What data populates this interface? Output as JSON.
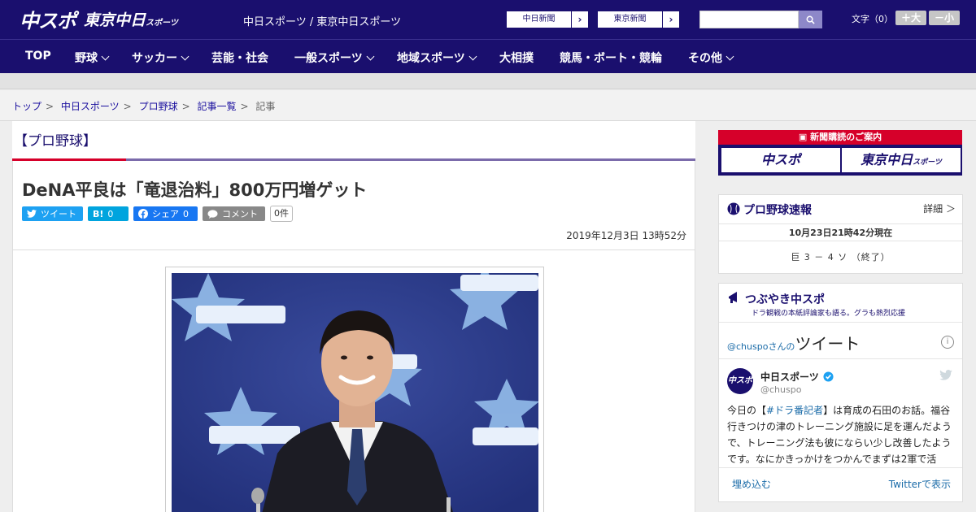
{
  "header": {
    "logo_primary": "中スポ",
    "logo_secondary": "東京中日",
    "logo_secondary_small": "スポーツ",
    "site_title": "中日スポーツ / 東京中日スポーツ",
    "paper_links": [
      {
        "label": "中日新聞"
      },
      {
        "label": "東京新聞"
      }
    ],
    "search_placeholder": "",
    "font_size_label": "文字（0）",
    "font_larger": "＋大",
    "font_smaller": "－小"
  },
  "nav": {
    "items": [
      {
        "label": "TOP",
        "has_dropdown": false
      },
      {
        "label": "野球",
        "has_dropdown": true
      },
      {
        "label": "サッカー",
        "has_dropdown": true
      },
      {
        "label": "芸能・社会",
        "has_dropdown": false
      },
      {
        "label": "一般スポーツ",
        "has_dropdown": true
      },
      {
        "label": "地域スポーツ",
        "has_dropdown": true
      },
      {
        "label": "大相撲",
        "has_dropdown": false
      },
      {
        "label": "競馬・ボート・競輪",
        "has_dropdown": false
      },
      {
        "label": "その他",
        "has_dropdown": true
      }
    ]
  },
  "breadcrumb": {
    "links": [
      "トップ",
      "中日スポーツ",
      "プロ野球",
      "記事一覧"
    ],
    "current": "記事"
  },
  "article": {
    "category": "【プロ野球】",
    "headline": "DeNA平良は「竜退治料」800万円増ゲット",
    "share": {
      "tweet": "ツイート",
      "hatena_label": "B!",
      "hatena_count": "0",
      "facebook": "シェア",
      "facebook_count": "0",
      "comment": "コメント",
      "comment_count": "0件"
    },
    "date": "2019年12月3日 13時52分"
  },
  "sidebar": {
    "subscription": {
      "title": "新聞購読のご案内",
      "left": "中スポ",
      "right": "東京中日",
      "right_small": "スポーツ"
    },
    "score": {
      "title": "プロ野球速報",
      "detail": "詳細 ＞",
      "time": "10月23日21時42分現在",
      "line": "巨 3 － 4 ソ （終了）"
    },
    "tweets": {
      "title": "つぶやき中スポ",
      "subtitle": "ドラ観戦の本紙評論家も語る。グラも熱烈応援",
      "handle_link": "@chuspo",
      "handle_suffix": "さんの",
      "header_big": "ツイート",
      "info": "i",
      "account_name": "中日スポーツ",
      "account_handle": "@chuspo",
      "avatar_text": "中スポ",
      "text_before": "今日の【",
      "text_tag": "#ドラ番記者",
      "text_after": "】は育成の石田のお話。福谷行きつけの津のトレーニング施設に足を運んだようで、トレーニング法も彼にならい少し改善したようです。なにかきっかけをつかんでまずは2軍で活",
      "embed": "埋め込む",
      "view_on_twitter": "Twitterで表示"
    }
  },
  "colors": {
    "brand": "#1a0f6e",
    "accent_red": "#d6002a",
    "twitter_blue": "#1da1f2",
    "hatena_blue": "#00a4de",
    "facebook_blue": "#1877f2"
  }
}
